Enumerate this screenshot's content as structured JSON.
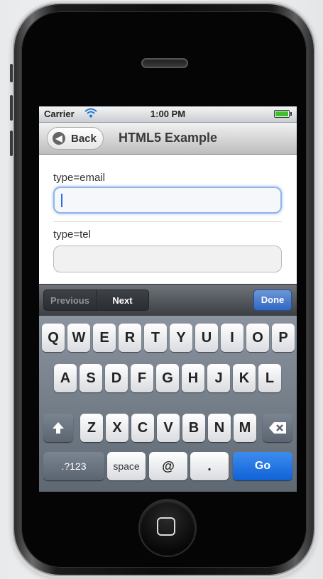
{
  "status_bar": {
    "carrier": "Carrier",
    "time": "1:00 PM",
    "wifi_icon": "wifi-icon",
    "battery_level": 1.0,
    "battery_color": "#3fbf2a"
  },
  "nav": {
    "back_label": "Back",
    "title": "HTML5 Example"
  },
  "form": {
    "email_label": "type=email",
    "email_value": "",
    "tel_label": "type=tel",
    "tel_value": ""
  },
  "accessory": {
    "previous_label": "Previous",
    "next_label": "Next",
    "done_label": "Done"
  },
  "keyboard": {
    "row1": [
      "Q",
      "W",
      "E",
      "R",
      "T",
      "Y",
      "U",
      "I",
      "O",
      "P"
    ],
    "row2": [
      "A",
      "S",
      "D",
      "F",
      "G",
      "H",
      "J",
      "K",
      "L"
    ],
    "row3": [
      "Z",
      "X",
      "C",
      "V",
      "B",
      "N",
      "M"
    ],
    "numbers_label": ".?123",
    "space_label": "space",
    "at_label": "@",
    "dot_label": ".",
    "go_label": "Go",
    "shift_icon": "shift-arrow-icon",
    "delete_icon": "backspace-icon"
  },
  "colors": {
    "accent_blue": "#1062d6",
    "done_blue": "#2f68c4",
    "caret_blue": "#2f6ae8"
  }
}
